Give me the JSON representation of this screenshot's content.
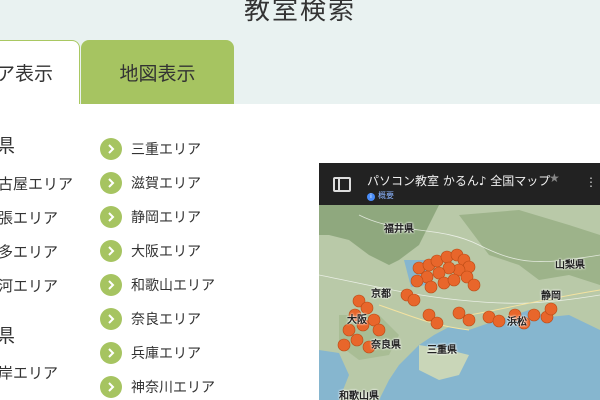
{
  "page": {
    "title": "教室検索"
  },
  "tabs": [
    {
      "label": "ア表示",
      "active": true
    },
    {
      "label": "地図表示",
      "active": false
    }
  ],
  "colors": {
    "accent": "#a6c461",
    "header_bg": "#e9f2f1",
    "pin": "#e8662b"
  },
  "left_column": {
    "prefectures": [
      "県",
      "県"
    ],
    "areas": [
      "古屋エリア",
      "張エリア",
      "多エリア",
      "河エリア",
      "岸エリア"
    ]
  },
  "area_list": {
    "icon": "chevron-right-icon",
    "items": [
      {
        "label": "三重エリア"
      },
      {
        "label": "滋賀エリア"
      },
      {
        "label": "静岡エリア"
      },
      {
        "label": "大阪エリア"
      },
      {
        "label": "和歌山エリア"
      },
      {
        "label": "奈良エリア"
      },
      {
        "label": "兵庫エリア"
      },
      {
        "label": "神奈川エリア"
      }
    ]
  },
  "map": {
    "title": "パソコン教室 かるん♪ 全国マップ",
    "subtitle": "概要",
    "star_icon": "★",
    "share_icon": "⋮",
    "places": [
      "福井県",
      "京都",
      "静岡",
      "山梨県",
      "三重県",
      "奈良県",
      "和歌山県",
      "大阪",
      "浜松"
    ]
  }
}
